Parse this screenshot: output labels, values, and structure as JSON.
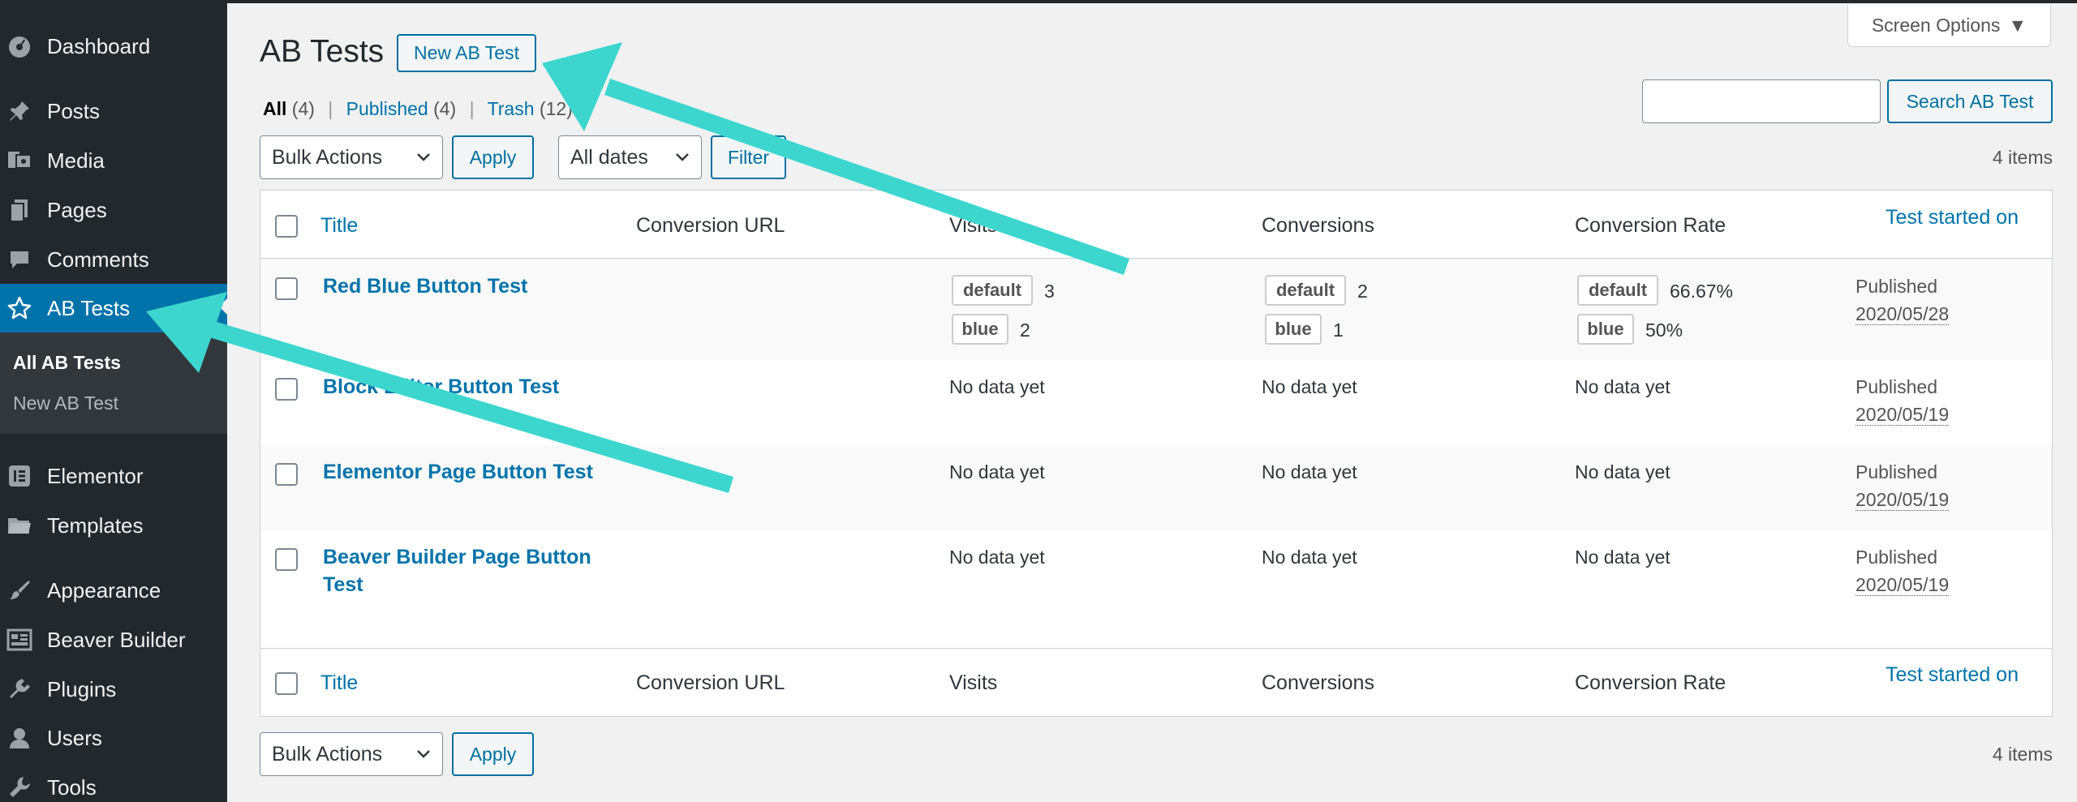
{
  "sidebar": {
    "items": [
      {
        "label": "Dashboard",
        "icon": "dashboard-icon"
      },
      {
        "label": "Posts",
        "icon": "pin-icon"
      },
      {
        "label": "Media",
        "icon": "media-icon"
      },
      {
        "label": "Pages",
        "icon": "pages-icon"
      },
      {
        "label": "Comments",
        "icon": "comment-icon"
      },
      {
        "label": "AB Tests",
        "icon": "star-icon"
      },
      {
        "label": "Elementor",
        "icon": "elementor-icon"
      },
      {
        "label": "Templates",
        "icon": "folder-icon"
      },
      {
        "label": "Appearance",
        "icon": "brush-icon"
      },
      {
        "label": "Beaver Builder",
        "icon": "layout-icon"
      },
      {
        "label": "Plugins",
        "icon": "plug-icon"
      },
      {
        "label": "Users",
        "icon": "user-icon"
      },
      {
        "label": "Tools",
        "icon": "wrench-icon"
      }
    ],
    "submenu": [
      "All AB Tests",
      "New AB Test"
    ],
    "colors": {
      "bg": "#23282d",
      "active": "#0073aa",
      "submenu_bg": "#32373c"
    }
  },
  "header": {
    "title": "AB Tests",
    "new_button": "New AB Test",
    "screen_options": "Screen Options"
  },
  "filters": {
    "all_label": "All",
    "all_count": "(4)",
    "published_label": "Published",
    "published_count": "(4)",
    "trash_label": "Trash",
    "trash_count": "(12)",
    "sep": "|"
  },
  "search": {
    "button": "Search AB Test",
    "value": ""
  },
  "actions": {
    "bulk": "Bulk Actions",
    "apply": "Apply",
    "dates": "All dates",
    "filter": "Filter",
    "items_count": "4 items"
  },
  "table": {
    "columns": {
      "title": "Title",
      "conversion_url": "Conversion URL",
      "visits": "Visits",
      "conversions": "Conversions",
      "conversion_rate": "Conversion Rate",
      "started": "Test started on"
    },
    "rows": [
      {
        "title": "Red Blue Button Test",
        "visits": [
          {
            "tag": "default",
            "value": "3"
          },
          {
            "tag": "blue",
            "value": "2"
          }
        ],
        "conversions": [
          {
            "tag": "default",
            "value": "2"
          },
          {
            "tag": "blue",
            "value": "1"
          }
        ],
        "rates": [
          {
            "tag": "default",
            "value": "66.67%"
          },
          {
            "tag": "blue",
            "value": "50%"
          }
        ],
        "status": "Published",
        "date": "2020/05/28"
      },
      {
        "title": "Block Editor Button Test",
        "visits_text": "No data yet",
        "conversions_text": "No data yet",
        "rate_text": "No data yet",
        "status": "Published",
        "date": "2020/05/19"
      },
      {
        "title": "Elementor Page Button Test",
        "visits_text": "No data yet",
        "conversions_text": "No data yet",
        "rate_text": "No data yet",
        "status": "Published",
        "date": "2020/05/19"
      },
      {
        "title_line1": "Beaver Builder Page Button",
        "title_line2": "Test",
        "visits_text": "No data yet",
        "conversions_text": "No data yet",
        "rate_text": "No data yet",
        "status": "Published",
        "date": "2020/05/19"
      }
    ]
  },
  "annotation_color": "#3dd6cf"
}
